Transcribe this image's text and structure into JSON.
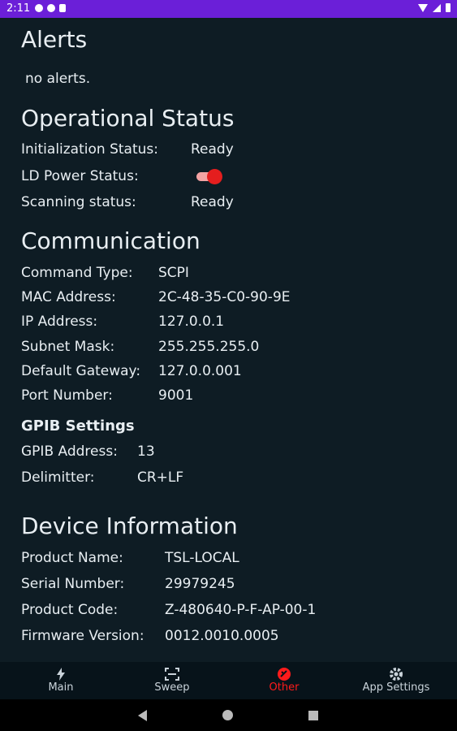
{
  "status_bar": {
    "time": "2:11"
  },
  "alerts": {
    "title": "Alerts",
    "message": "no alerts."
  },
  "operational": {
    "title": "Operational Status",
    "rows": [
      {
        "label": "Initialization Status:",
        "value": "Ready"
      },
      {
        "label": "LD Power Status:",
        "value": ""
      },
      {
        "label": "Scanning status:",
        "value": "Ready"
      }
    ],
    "ld_power_on": true
  },
  "communication": {
    "title": "Communication",
    "rows": [
      {
        "label": "Command Type:",
        "value": "SCPI"
      },
      {
        "label": "MAC Address:",
        "value": "2C-48-35-C0-90-9E"
      },
      {
        "label": "IP Address:",
        "value": "127.0.0.1"
      },
      {
        "label": "Subnet Mask:",
        "value": "255.255.255.0"
      },
      {
        "label": "Default Gateway:",
        "value": "127.0.0.001"
      },
      {
        "label": "Port Number:",
        "value": "9001"
      }
    ]
  },
  "gpib": {
    "title": "GPIB Settings",
    "rows": [
      {
        "label": "GPIB Address:",
        "value": "13"
      },
      {
        "label": "Delimitter:",
        "value": "CR+LF"
      }
    ]
  },
  "device": {
    "title": "Device Information",
    "rows": [
      {
        "label": "Product Name:",
        "value": "TSL-LOCAL"
      },
      {
        "label": "Serial Number:",
        "value": "29979245"
      },
      {
        "label": "Product Code:",
        "value": "Z-480640-P-F-AP-00-1"
      },
      {
        "label": "Firmware Version:",
        "value": "0012.0010.0005"
      }
    ]
  },
  "nav": {
    "items": [
      {
        "label": "Main",
        "icon": "bolt-icon"
      },
      {
        "label": "Sweep",
        "icon": "scan-icon"
      },
      {
        "label": "Other",
        "icon": "other-icon",
        "active": true
      },
      {
        "label": "App Settings",
        "icon": "gear-icon"
      }
    ]
  },
  "colors": {
    "status_bar": "#6b1fd8",
    "background": "#0e1c24",
    "accent": "#ff1b1b"
  }
}
